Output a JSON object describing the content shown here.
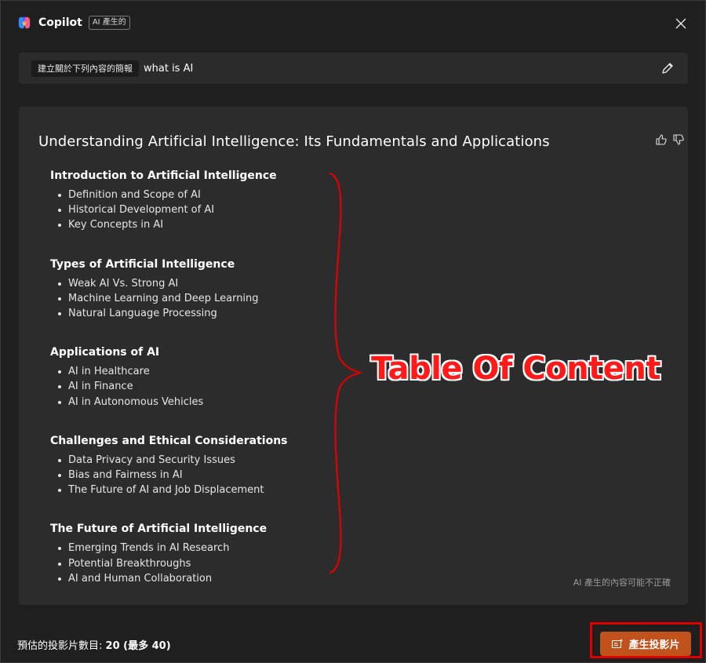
{
  "header": {
    "app_name": "Copilot",
    "badge": "AI 產生的"
  },
  "prompt": {
    "chip": "建立關於下列內容的簡報",
    "text": "what is AI"
  },
  "outline": {
    "title": "Understanding Artificial Intelligence: Its Fundamentals and Applications",
    "sections": [
      {
        "heading": "Introduction to Artificial Intelligence",
        "items": [
          "Definition and Scope of AI",
          "Historical Development of AI",
          "Key Concepts in AI"
        ]
      },
      {
        "heading": "Types of Artificial Intelligence",
        "items": [
          "Weak AI Vs. Strong AI",
          "Machine Learning and Deep Learning",
          "Natural Language Processing"
        ]
      },
      {
        "heading": "Applications of AI",
        "items": [
          "AI in Healthcare",
          "AI in Finance",
          "AI in Autonomous Vehicles"
        ]
      },
      {
        "heading": "Challenges and Ethical Considerations",
        "items": [
          "Data Privacy and Security Issues",
          "Bias and Fairness in AI",
          "The Future of AI and Job Displacement"
        ]
      },
      {
        "heading": "The Future of Artificial Intelligence",
        "items": [
          "Emerging Trends in AI Research",
          "Potential Breakthroughs",
          "AI and Human Collaboration"
        ]
      }
    ],
    "disclaimer": "AI 產生的內容可能不正確"
  },
  "annotation": {
    "label": "Table Of Content",
    "color": "#e00000"
  },
  "footer": {
    "count_label": "預估的投影片數目:",
    "count_value": "20 (最多 40)",
    "generate_label": "產生投影片",
    "generate_color": "#c2521c"
  }
}
